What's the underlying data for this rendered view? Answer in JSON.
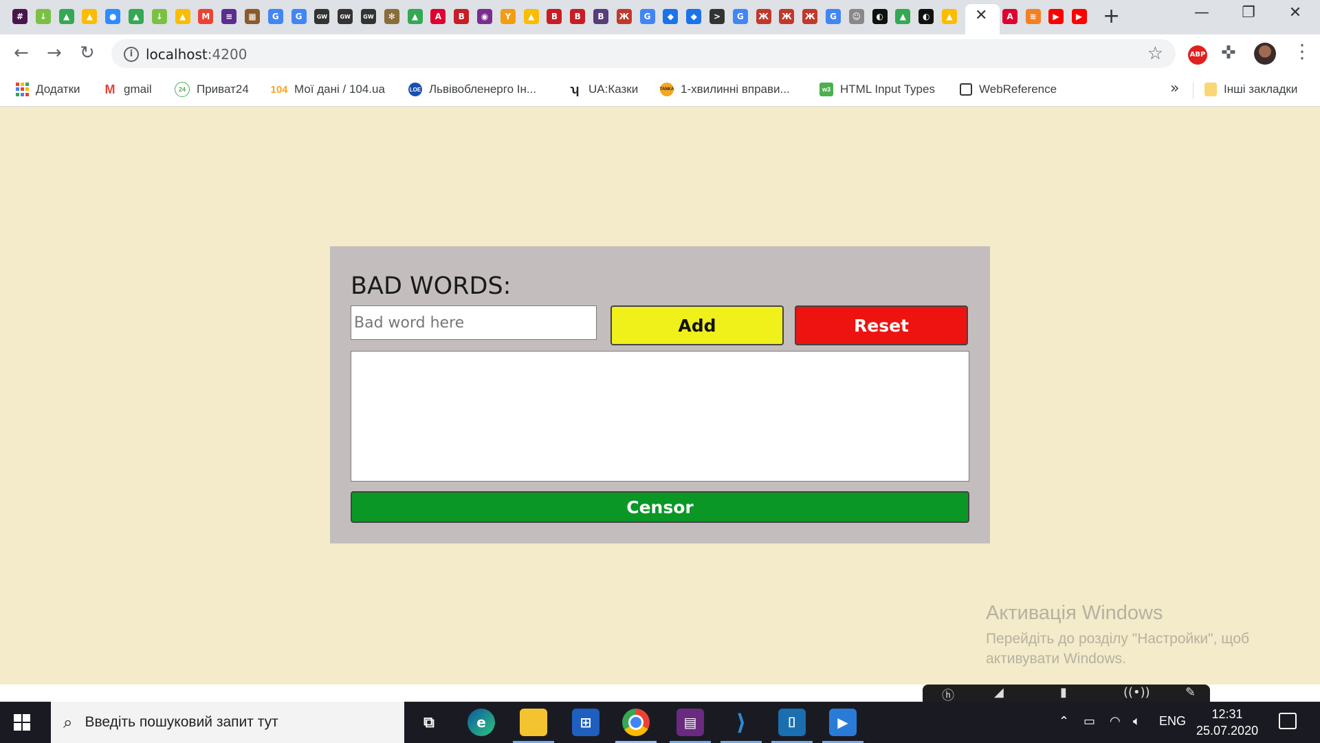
{
  "browser": {
    "tab_favicons": [
      {
        "name": "slack",
        "color": "#4a154b",
        "glyph": "#"
      },
      {
        "name": "download",
        "color": "#7ac143",
        "glyph": "↓"
      },
      {
        "name": "drive",
        "color": "#34a853",
        "glyph": "▲"
      },
      {
        "name": "drive",
        "color": "#fbbc04",
        "glyph": "▲"
      },
      {
        "name": "zoom",
        "color": "#2d8cff",
        "glyph": "●"
      },
      {
        "name": "drive",
        "color": "#34a853",
        "glyph": "▲"
      },
      {
        "name": "download",
        "color": "#7ac143",
        "glyph": "↓"
      },
      {
        "name": "drive",
        "color": "#fbbc04",
        "glyph": "▲"
      },
      {
        "name": "gmail",
        "color": "#ea4335",
        "glyph": "M"
      },
      {
        "name": "list",
        "color": "#5b2d8e",
        "glyph": "≡"
      },
      {
        "name": "film",
        "color": "#8b5a2b",
        "glyph": "▦"
      },
      {
        "name": "translate",
        "color": "#4285f4",
        "glyph": "G"
      },
      {
        "name": "translate",
        "color": "#4285f4",
        "glyph": "G"
      },
      {
        "name": "gw",
        "color": "#333333",
        "glyph": "GW"
      },
      {
        "name": "gw",
        "color": "#333333",
        "glyph": "GW"
      },
      {
        "name": "gw",
        "color": "#333333",
        "glyph": "GW"
      },
      {
        "name": "tree",
        "color": "#8a6d3b",
        "glyph": "✻"
      },
      {
        "name": "drive",
        "color": "#34a853",
        "glyph": "▲"
      },
      {
        "name": "angular",
        "color": "#dd0031",
        "glyph": "A"
      },
      {
        "name": "bootstrap",
        "color": "#c81d25",
        "glyph": "B"
      },
      {
        "name": "eye",
        "color": "#7b2d8e",
        "glyph": "◉"
      },
      {
        "name": "figure",
        "color": "#f39c12",
        "glyph": "Y"
      },
      {
        "name": "drive",
        "color": "#fbbc04",
        "glyph": "▲"
      },
      {
        "name": "bootstrap",
        "color": "#c81d25",
        "glyph": "B"
      },
      {
        "name": "bootstrap",
        "color": "#c81d25",
        "glyph": "B"
      },
      {
        "name": "bootstrap",
        "color": "#563d7c",
        "glyph": "B"
      },
      {
        "name": "tower",
        "color": "#c0392b",
        "glyph": "Ж"
      },
      {
        "name": "google",
        "color": "#4285f4",
        "glyph": "G"
      },
      {
        "name": "edu",
        "color": "#1a73e8",
        "glyph": "◆"
      },
      {
        "name": "edu",
        "color": "#1a73e8",
        "glyph": "◆"
      },
      {
        "name": "terminal",
        "color": "#333333",
        "glyph": ">"
      },
      {
        "name": "google",
        "color": "#4285f4",
        "glyph": "G"
      },
      {
        "name": "tower",
        "color": "#c0392b",
        "glyph": "Ж"
      },
      {
        "name": "tower",
        "color": "#c0392b",
        "glyph": "Ж"
      },
      {
        "name": "tower",
        "color": "#c0392b",
        "glyph": "Ж"
      },
      {
        "name": "google",
        "color": "#4285f4",
        "glyph": "G"
      },
      {
        "name": "robot",
        "color": "#888888",
        "glyph": "☺"
      },
      {
        "name": "github",
        "color": "#111111",
        "glyph": "◐"
      },
      {
        "name": "drive",
        "color": "#34a853",
        "glyph": "▲"
      },
      {
        "name": "github",
        "color": "#111111",
        "glyph": "◐"
      },
      {
        "name": "drive",
        "color": "#fbbc04",
        "glyph": "▲"
      }
    ],
    "tab_favicons_after": [
      {
        "name": "angular",
        "color": "#dd0031",
        "glyph": "A"
      },
      {
        "name": "stackoverflow",
        "color": "#f48024",
        "glyph": "≋"
      },
      {
        "name": "youtube",
        "color": "#ff0000",
        "glyph": "▶"
      },
      {
        "name": "youtube",
        "color": "#ff0000",
        "glyph": "▶"
      }
    ],
    "active_tab_close": "✕",
    "new_tab": "+",
    "url_host": "localhost",
    "url_port": ":4200",
    "abp_label": "ABP",
    "bookmarks": [
      {
        "label": "Додатки",
        "icon": "apps-icon",
        "color": "#ea4335"
      },
      {
        "label": "gmail",
        "icon": "gmail-icon",
        "color": "#ea4335"
      },
      {
        "label": "Приват24",
        "icon": "privat24-icon",
        "color": "#4caf50"
      },
      {
        "label": "Мої дані / 104.ua",
        "icon": "104-icon",
        "color": "#f5a623"
      },
      {
        "label": "Львівобленерго Ін...",
        "icon": "loe-icon",
        "color": "#1a4fb3"
      },
      {
        "label": "UA:Казки",
        "icon": "uakazky-icon",
        "color": "#222222"
      },
      {
        "label": "1-хвилинні вправи...",
        "icon": "tanka-icon",
        "color": "#f5a623"
      },
      {
        "label": "HTML Input Types",
        "icon": "w3-icon",
        "color": "#4caf50"
      },
      {
        "label": "WebReference",
        "icon": "webref-icon",
        "color": "#333333"
      }
    ],
    "bookmarks_more": "»",
    "other_bookmarks": "Інші закладки"
  },
  "app": {
    "title": "BAD WORDS:",
    "input_placeholder": "Bad word here",
    "input_value": "",
    "add_label": "Add",
    "reset_label": "Reset",
    "textarea_value": "",
    "censor_label": "Censor",
    "colors": {
      "background": "#f3ebc9",
      "card": "#c3bebd",
      "add": "#f0f01a",
      "reset": "#ee1310",
      "censor": "#0a9726"
    }
  },
  "watermark": {
    "title": "Активація Windows",
    "line1": "Перейдіть до розділу \"Настройки\", щоб",
    "line2": "активувати Windows."
  },
  "taskbar": {
    "search_placeholder": "Введіть пошуковий запит тут",
    "language": "ENG",
    "time": "12:31",
    "date": "25.07.2020"
  }
}
